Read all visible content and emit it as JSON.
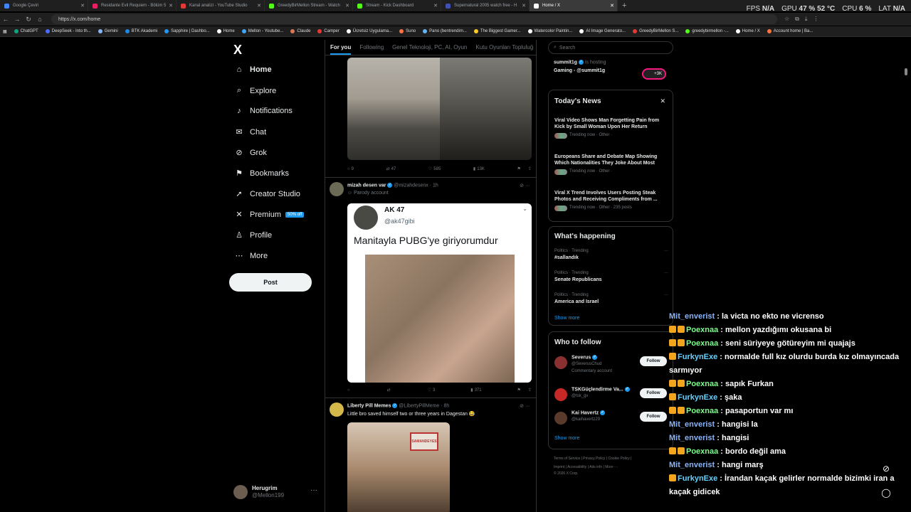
{
  "browser": {
    "tabs": [
      {
        "title": "Google Çeviri",
        "color": "#4285f4"
      },
      {
        "title": "Residante Evil Requiem - Bölüm 5",
        "color": "#e91e63"
      },
      {
        "title": "Kanal analizi - YouTube Studio",
        "color": "#e53935"
      },
      {
        "title": "GreedyBirMellon Stream - Watch",
        "color": "#53fc18"
      },
      {
        "title": "Stream - Kick Dashboard",
        "color": "#53fc18"
      },
      {
        "title": "Supernatural 2005 watch free - H",
        "color": "#3f51b5"
      },
      {
        "title": "Home / X",
        "color": "#ffffff"
      }
    ],
    "url": "https://x.com/home",
    "bookmarks": [
      {
        "label": "ChatGPT",
        "color": "#10a37f"
      },
      {
        "label": "DeepSeek - Into th...",
        "color": "#4d6bfe"
      },
      {
        "label": "Gemini",
        "color": "#8ab4f8"
      },
      {
        "label": "BTK Akademi",
        "color": "#1e88e5"
      },
      {
        "label": "Sapphire | Dashbo...",
        "color": "#2196f3"
      },
      {
        "label": "Home",
        "color": "#ffffff"
      },
      {
        "label": "Mellon - Youtube...",
        "color": "#42a5f5"
      },
      {
        "label": "Claude",
        "color": "#d97757"
      },
      {
        "label": "Camper",
        "color": "#e53935"
      },
      {
        "label": "Ücretsiz Uygulama...",
        "color": "#ffffff"
      },
      {
        "label": "Suno",
        "color": "#ff7043"
      },
      {
        "label": "Pano (bentrendim...",
        "color": "#64b5f6"
      },
      {
        "label": "The Biggest Gamer...",
        "color": "#ffca28"
      },
      {
        "label": "Watercolor Paintin...",
        "color": "#ffffff"
      },
      {
        "label": "AI Image Generato...",
        "color": "#ffffff"
      },
      {
        "label": "GreedyBirMellon S...",
        "color": "#e53935"
      },
      {
        "label": "greedybirmellon -...",
        "color": "#53fc18"
      },
      {
        "label": "Home / X",
        "color": "#ffffff"
      },
      {
        "label": "Account home | Ba...",
        "color": "#ff7043"
      }
    ]
  },
  "overlay": {
    "fps_label": "FPS",
    "fps_value": "N/A",
    "gpu_label": "GPU",
    "gpu_value": "47 % 52 °C",
    "cpu_label": "CPU",
    "cpu_value": "6 %",
    "lat_label": "LAT",
    "lat_value": "N/A"
  },
  "sidebar": {
    "logo": "X",
    "items": [
      {
        "label": "Home",
        "icon": "home-icon",
        "glyph": "⌂"
      },
      {
        "label": "Explore",
        "icon": "search-icon",
        "glyph": "⌕"
      },
      {
        "label": "Notifications",
        "icon": "bell-icon",
        "glyph": "♪"
      },
      {
        "label": "Chat",
        "icon": "mail-icon",
        "glyph": "✉"
      },
      {
        "label": "Grok",
        "icon": "grok-icon",
        "glyph": "⊘"
      },
      {
        "label": "Bookmarks",
        "icon": "bookmark-icon",
        "glyph": "⚑"
      },
      {
        "label": "Creator Studio",
        "icon": "rocket-icon",
        "glyph": "➚"
      },
      {
        "label": "Premium",
        "icon": "x-icon",
        "glyph": "✕"
      },
      {
        "label": "Profile",
        "icon": "person-icon",
        "glyph": "♙"
      },
      {
        "label": "More",
        "icon": "more-icon",
        "glyph": "⋯"
      }
    ],
    "premium_badge": "50% off",
    "post_label": "Post",
    "account": {
      "name": "Herugrim",
      "handle": "@Mellon199"
    }
  },
  "feed": {
    "tabs": [
      "For you",
      "Following",
      "Genel Teknoloji, PC, AI, Oyun",
      "Kutu Oyunları Topluluğ"
    ],
    "post1_actions": {
      "replies": "9",
      "reposts": "47",
      "likes": "585",
      "views": "13K"
    },
    "post2": {
      "name": "mizah desen var",
      "handle": "@mizahdesenx",
      "time": "· 1h",
      "sub": "Parody account",
      "quote_name": "AK 47",
      "quote_handle": "@ak47gibi",
      "quote_text": "Manitayla PUBG'ye giriyorumdur",
      "actions": {
        "replies": "",
        "reposts": "",
        "likes": "3",
        "views": "371"
      }
    },
    "post3": {
      "name": "Liberty Pill Memes",
      "handle": "@LibertyPillMeme",
      "time": "· 8h",
      "text": "Little bro saved himself two or three years in Dagestan 😂",
      "sign_text": "SAMANDEYES"
    }
  },
  "right": {
    "search_placeholder": "Search",
    "hosting": {
      "host": "summit1g",
      "is": "is hosting",
      "game": "Gaming - @summit1g",
      "count": "+3K"
    },
    "news_title": "Today's News",
    "news": [
      {
        "title": "Viral Video Shows Man Forgetting Pain from Kick by Small Woman Upon Her Return",
        "meta": "Trending now · Other ·"
      },
      {
        "title": "Europeans Share and Debate Map Showing Which Nationalities They Joke About Most",
        "meta": "Trending now · Other ·"
      },
      {
        "title": "Viral X Trend Involves Users Posting Steak Photos and Receiving Compliments from ...",
        "meta": "Trending now · Other · 235 posts"
      }
    ],
    "happening_title": "What's happening",
    "trends": [
      {
        "cat": "Politics · Trending",
        "name": "#sallandık"
      },
      {
        "cat": "Politics · Trending",
        "name": "Senate Republicans"
      },
      {
        "cat": "Politics · Trending",
        "name": "America and Israel"
      }
    ],
    "show_more": "Show more",
    "follow_title": "Who to follow",
    "follows": [
      {
        "name": "Severus",
        "handle": "@SeverusChud",
        "extra": "Commentary account",
        "color": "#8a3030"
      },
      {
        "name": "TSKGüçlendirme Va...",
        "handle": "@tsk_gv",
        "extra": "",
        "color": "#c62828"
      },
      {
        "name": "Kai Havertz",
        "handle": "@kaihavertz29",
        "extra": "",
        "color": "#5a3a2a"
      }
    ],
    "follow_label": "Follow",
    "footer_line1": "Terms of Service  |  Privacy Policy  |  Cookie Policy  |",
    "footer_line2": "Imprint  |  Accessibility  |  Ads info  |  More ···",
    "footer_line3": "© 2026 X Corp."
  },
  "chat": [
    {
      "user": "Mit_enverist",
      "style": "u1",
      "badges": 0,
      "msg": ": la victa no ekto ne vicrenso"
    },
    {
      "user": "Poexnaa",
      "style": "u2",
      "badges": 2,
      "msg": ": mellon yazdığımı okusana bi"
    },
    {
      "user": "Poexnaa",
      "style": "u2",
      "badges": 2,
      "msg": ": seni süriyeye götüreyim mi quajajs"
    },
    {
      "user": "FurkynExe",
      "style": "u3",
      "badges": 1,
      "msg": ": normalde full kız olurdu burda kız olmayıncada sarmıyor"
    },
    {
      "user": "Poexnaa",
      "style": "u2",
      "badges": 2,
      "msg": ": sapık Furkan"
    },
    {
      "user": "FurkynExe",
      "style": "u3",
      "badges": 1,
      "msg": ": şaka"
    },
    {
      "user": "Poexnaa",
      "style": "u2",
      "badges": 2,
      "msg": ": pasaportun var mı"
    },
    {
      "user": "Mit_enverist",
      "style": "u1",
      "badges": 0,
      "msg": ": hangisi la"
    },
    {
      "user": "Mit_enverist",
      "style": "u1",
      "badges": 0,
      "msg": ": hangisi"
    },
    {
      "user": "Poexnaa",
      "style": "u2",
      "badges": 2,
      "msg": ": bordo değil ama"
    },
    {
      "user": "Mit_enverist",
      "style": "u1",
      "badges": 0,
      "msg": ": hangi marş"
    },
    {
      "user": "FurkynExe",
      "style": "u3",
      "badges": 1,
      "msg": ": İrandan kaçak gelirler normalde bizimki iran a kaçak gidicek"
    }
  ]
}
